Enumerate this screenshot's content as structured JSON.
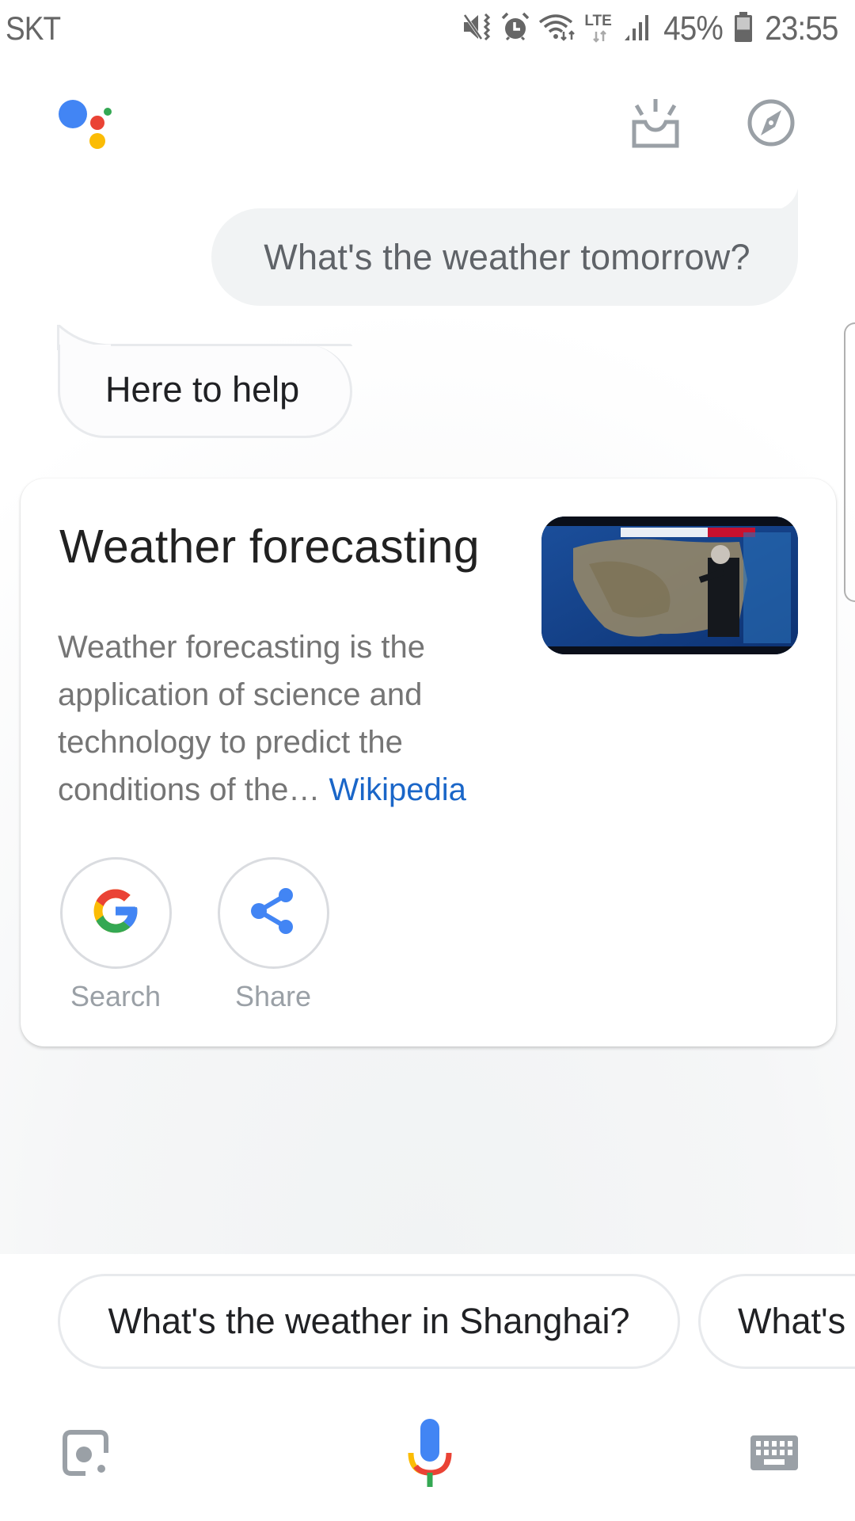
{
  "status_bar": {
    "carrier": "SKT",
    "icons": [
      "vibrate-mute-icon",
      "alarm-icon",
      "wifi-icon",
      "lte-icon",
      "signal-icon"
    ],
    "lte_label": "LTE",
    "battery_percent_text": "45%",
    "battery_level": 0.45,
    "time": "23:55"
  },
  "header": {
    "logo": "google-assistant-logo",
    "updates_icon": "updates-tray-icon",
    "explore_icon": "compass-icon",
    "logo_colors": {
      "blue": "#4285f4",
      "red": "#ea4335",
      "yellow": "#fbbc05",
      "green": "#34a853"
    },
    "icon_color": "#9aa0a6"
  },
  "conversation": {
    "user_query": "What's the weather tomorrow?",
    "assistant_reply": "Here to help"
  },
  "card": {
    "title": "Weather forecasting",
    "description": "Weather forecasting is the application of science and technology to predict the conditions of the…",
    "source_link": "Wikipedia",
    "thumbnail": "weather-forecast-tv-map-image",
    "actions": [
      {
        "label": "Search",
        "icon": "google-g-icon"
      },
      {
        "label": "Share",
        "icon": "share-icon"
      }
    ],
    "link_color": "#1a66c8"
  },
  "suggestions": [
    "What's the weather in Shanghai?",
    "What's"
  ],
  "bottom_bar": {
    "left_icon": "google-lens-icon",
    "center_icon": "microphone-icon",
    "right_icon": "keyboard-icon"
  }
}
